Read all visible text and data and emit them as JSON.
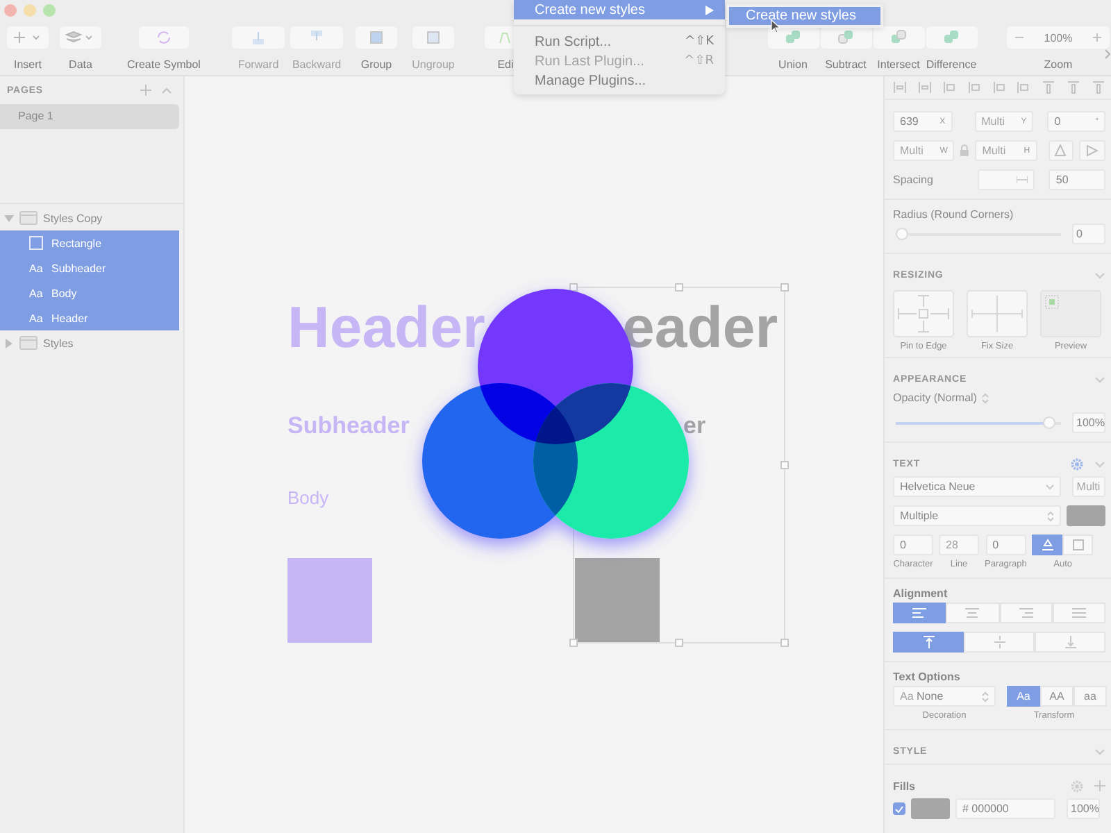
{
  "toolbar": {
    "items": [
      {
        "kind": "insert",
        "label": "Insert",
        "disabled": false
      },
      {
        "kind": "data",
        "label": "Data",
        "disabled": false
      },
      {
        "kind": "symbol",
        "label": "Create Symbol",
        "disabled": false
      },
      {
        "kind": "forward",
        "label": "Forward",
        "disabled": true
      },
      {
        "kind": "backward",
        "label": "Backward",
        "disabled": true
      },
      {
        "kind": "group",
        "label": "Group",
        "disabled": false
      },
      {
        "kind": "ungroup",
        "label": "Ungroup",
        "disabled": true
      },
      {
        "kind": "edit",
        "label": "Edi",
        "disabled": false
      }
    ],
    "boolean_ops": [
      {
        "kind": "union",
        "label": "Union"
      },
      {
        "kind": "subtract",
        "label": "Subtract"
      },
      {
        "kind": "intersect",
        "label": "Intersect"
      },
      {
        "kind": "difference",
        "label": "Difference"
      }
    ],
    "zoom": {
      "value": "100%",
      "label": "Zoom"
    }
  },
  "menu": {
    "items": [
      {
        "kind": "submenu",
        "label": "Create new styles",
        "selected": true,
        "disabled": false
      },
      {
        "kind": "separator"
      },
      {
        "kind": "command",
        "label": "Run Script...",
        "shortcut": "^⇧K",
        "selected": false,
        "disabled": false
      },
      {
        "kind": "command",
        "label": "Run Last Plugin...",
        "shortcut": "^⇧R",
        "selected": false,
        "disabled": true
      },
      {
        "kind": "command",
        "label": "Manage Plugins...",
        "selected": false,
        "disabled": false
      }
    ],
    "submenu": [
      {
        "label": "Create new styles",
        "selected": true
      }
    ]
  },
  "sidebar": {
    "pages_title": "PAGES",
    "pages": [
      {
        "label": "Page 1",
        "selected": true
      }
    ],
    "layers": [
      {
        "kind": "group",
        "name": "Styles Copy",
        "expanded": true,
        "selected": false,
        "children": [
          {
            "kind": "shape",
            "name": "Rectangle",
            "selected": true
          },
          {
            "kind": "text",
            "glyph": "Aa",
            "name": "Subheader",
            "selected": true
          },
          {
            "kind": "text",
            "glyph": "Aa",
            "name": "Body",
            "selected": true
          },
          {
            "kind": "text",
            "glyph": "Aa",
            "name": "Header",
            "selected": true
          }
        ]
      },
      {
        "kind": "group",
        "name": "Styles",
        "expanded": false,
        "selected": false
      }
    ]
  },
  "canvas": {
    "columns": [
      {
        "header": "Header",
        "subheader": "Subheader",
        "body": "Body",
        "color": "#c6b6f5"
      },
      {
        "header": "eader",
        "subheader": "er",
        "color": "#a4a4a4"
      }
    ]
  },
  "inspector": {
    "position": [
      {
        "value": "639",
        "suffix": "X"
      },
      {
        "placeholder": "Multi",
        "suffix": "Y"
      },
      {
        "value": "0",
        "suffix": "°"
      }
    ],
    "size": [
      {
        "placeholder": "Multi",
        "suffix": "W"
      },
      {
        "placeholder": "Multi",
        "suffix": "H"
      }
    ],
    "spacing": {
      "label": "Spacing",
      "value": "50"
    },
    "radius": {
      "label": "Radius (Round Corners)",
      "level": 0,
      "value": "0"
    },
    "resizing": {
      "title": "RESIZING",
      "options": [
        "Pin to Edge",
        "Fix Size",
        "Preview"
      ]
    },
    "appearance": {
      "title": "APPEARANCE",
      "opacity_label": "Opacity (Normal)",
      "level": 0.96,
      "value": "100%"
    },
    "text": {
      "title": "TEXT",
      "font": "Helvetica Neue",
      "weight_placeholder": "Multi",
      "style": "Multiple",
      "fields": [
        {
          "value": "0",
          "label": "Character"
        },
        {
          "placeholder": "28",
          "label": "Line"
        },
        {
          "value": "0",
          "label": "Paragraph"
        }
      ],
      "auto": [
        {
          "kind": "auto-width",
          "selected": true
        },
        {
          "kind": "fixed",
          "selected": false
        }
      ],
      "auto_label": "Auto",
      "alignment_title": "Alignment",
      "alignment": [
        {
          "kind": "left",
          "selected": true
        },
        {
          "kind": "center",
          "selected": false
        },
        {
          "kind": "right",
          "selected": false
        },
        {
          "kind": "justify",
          "selected": false
        }
      ],
      "vertical_alignment": [
        {
          "kind": "top",
          "selected": true
        },
        {
          "kind": "middle",
          "selected": false
        },
        {
          "kind": "bottom",
          "selected": false
        }
      ],
      "options_title": "Text Options",
      "decoration_sample": "Aa",
      "decoration": "None",
      "decoration_label": "Decoration",
      "transform": [
        {
          "label": "Aa",
          "selected": true
        },
        {
          "label": "AA",
          "selected": false
        },
        {
          "label": "aa",
          "selected": false
        }
      ],
      "transform_label": "Transform"
    },
    "style": {
      "title": "STYLE"
    },
    "fills": {
      "title": "Fills",
      "items": [
        {
          "enabled": true,
          "hex": "# 000000",
          "opacity": "100%"
        }
      ]
    }
  }
}
